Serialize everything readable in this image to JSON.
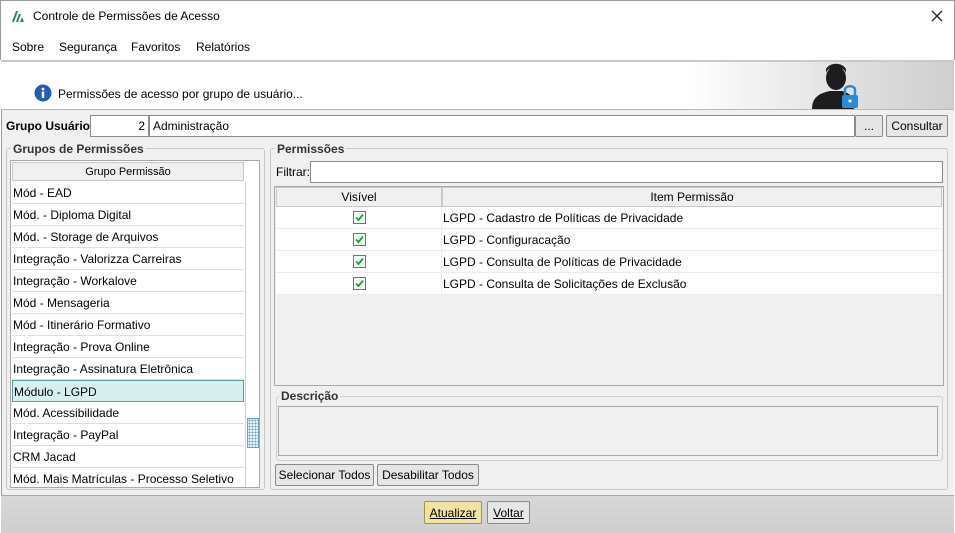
{
  "window": {
    "title": "Controle de Permissões de Acesso"
  },
  "menu": {
    "items": [
      "Sobre",
      "Segurança",
      "Favoritos",
      "Relatórios"
    ]
  },
  "banner": {
    "text": "Permissões de acesso por grupo de usuário..."
  },
  "grupo_usuario": {
    "label": "Grupo Usuário:",
    "code": "2",
    "name": "Administração",
    "browse_label": "...",
    "consult_label": "Consultar"
  },
  "grupos_permissoes": {
    "legend": "Grupos de Permissões",
    "column_header": "Grupo Permissão",
    "items": [
      "Mód - EAD",
      "Mód. - Diploma Digital",
      "Mód. - Storage de Arquivos",
      "Integração - Valorizza Carreiras",
      "Integração - Workalove",
      "Mód - Mensageria",
      "Mód - Itinerário Formativo",
      "Integração - Prova Online",
      "Integração - Assinatura Eletrônica",
      "Módulo - LGPD",
      "Mód. Acessibilidade",
      "Integração - PayPal",
      "CRM Jacad",
      "Mód. Mais Matrículas - Processo Seletivo"
    ],
    "selected_index": 9
  },
  "permissoes": {
    "legend": "Permissões",
    "filter_label": "Filtrar:",
    "filter_value": "",
    "columns": [
      "Visível",
      "Item Permissão"
    ],
    "rows": [
      {
        "visible": true,
        "item": "LGPD - Cadastro de Políticas de Privacidade"
      },
      {
        "visible": true,
        "item": "LGPD - Configuracação"
      },
      {
        "visible": true,
        "item": "LGPD - Consulta de Políticas de Privacidade"
      },
      {
        "visible": true,
        "item": "LGPD - Consulta de Solicitações de Exclusão"
      }
    ],
    "descricao_legend": "Descrição",
    "descricao_value": "",
    "select_all_label": "Selecionar Todos",
    "disable_all_label": "Desabilitar Todos"
  },
  "footer": {
    "atualizar_label": "Atualizar",
    "voltar_label": "Voltar"
  },
  "colors": {
    "selected_row": "#d7efef",
    "check_green": "#1e9e3a",
    "primary_button": "#f1e2a6",
    "logo": "#1b8a5a"
  }
}
